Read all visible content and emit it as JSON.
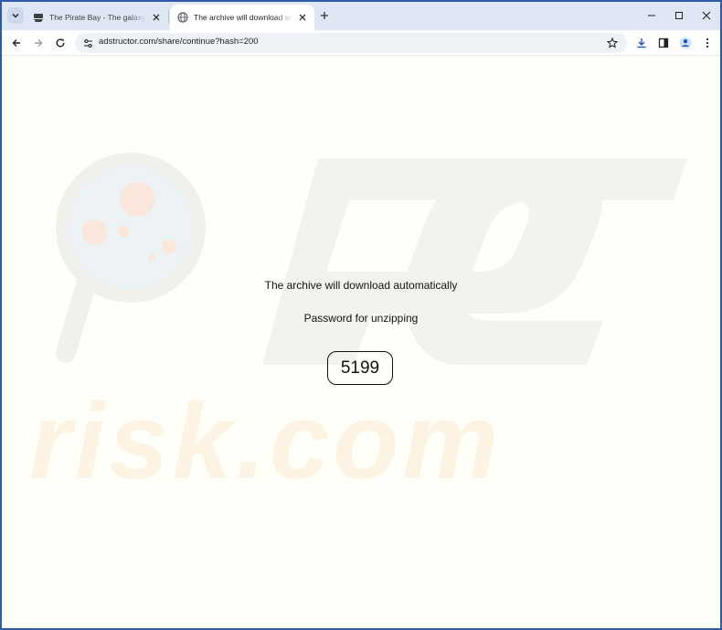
{
  "browser": {
    "tabs": [
      {
        "title": "The Pirate Bay - The galaxy's most resilient BitTorrent site",
        "favicon": "pirate-ship-icon",
        "active": false
      },
      {
        "title": "The archive will download automatically",
        "favicon": "globe-icon",
        "active": true
      }
    ],
    "new_tab_icon": "plus-icon",
    "window_controls": [
      "minimize-icon",
      "maximize-icon",
      "close-icon"
    ],
    "toolbar": {
      "back_icon": "arrow-left-icon",
      "forward_icon": "arrow-right-icon",
      "reload_icon": "reload-icon",
      "url": "adstructor.com/share/continue?hash=200",
      "site_info_icon": "tune-icon",
      "bookmark_icon": "star-icon",
      "right_icons": [
        "download-icon",
        "side-panel-icon",
        "profile-icon",
        "kebab-menu-icon"
      ]
    },
    "accent_color": "#2f5aa8"
  },
  "page": {
    "message": "The archive will download automatically",
    "password_label": "Password for unzipping",
    "password": "5199",
    "background_color": "#fffffa",
    "watermark": {
      "text": "risk.com",
      "logo": "pc",
      "icon": "magnifier-icon"
    }
  }
}
